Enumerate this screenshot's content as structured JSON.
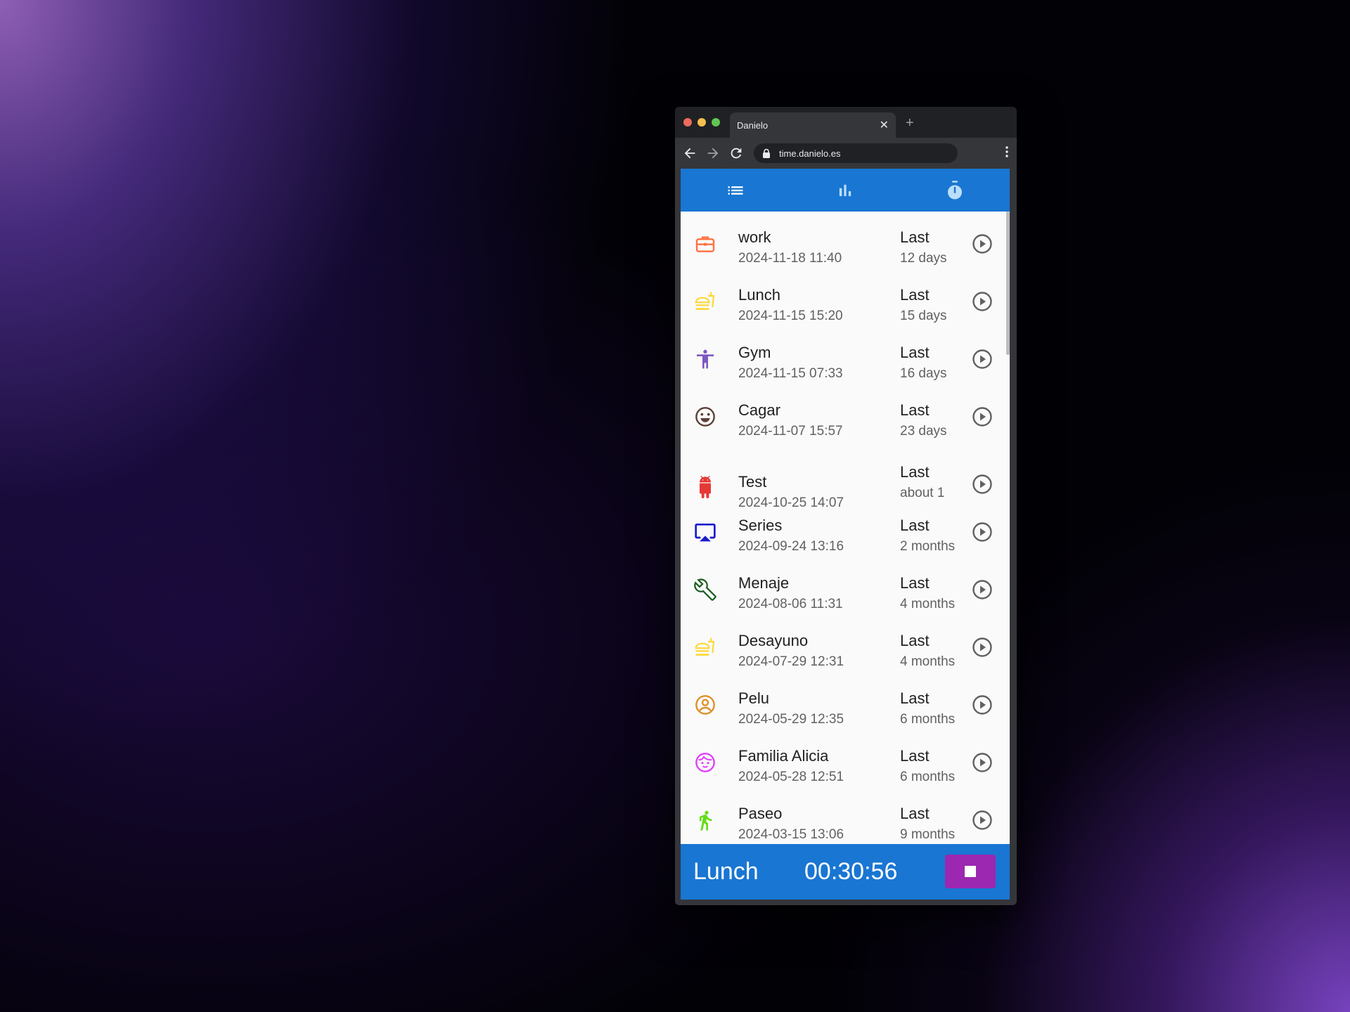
{
  "browser": {
    "tab_title": "Danielo",
    "url": "time.danielo.es",
    "close_glyph": "✕",
    "new_tab_glyph": "+"
  },
  "app_bar": {
    "tabs": [
      {
        "icon": "list-icon",
        "active": true
      },
      {
        "icon": "bar-chart-icon",
        "active": false
      },
      {
        "icon": "timer-icon",
        "active": false
      }
    ]
  },
  "activities": [
    {
      "name": "work",
      "date": "2024-11-18 11:40",
      "last_label": "Last",
      "ago": "12 days",
      "icon": "briefcase-icon",
      "color": "#ff7043"
    },
    {
      "name": "Lunch",
      "date": "2024-11-15 15:20",
      "last_label": "Last",
      "ago": "15 days",
      "icon": "fastfood-icon",
      "color": "#fdd835"
    },
    {
      "name": "Gym",
      "date": "2024-11-15 07:33",
      "last_label": "Last",
      "ago": "16 days",
      "icon": "accessibility-icon",
      "color": "#7e57c2"
    },
    {
      "name": "Cagar",
      "date": "2024-11-07 15:57",
      "last_label": "Last",
      "ago": "23 days",
      "icon": "smiley-icon",
      "color": "#5d4037"
    },
    {
      "name": "Test",
      "date": "2024-10-25 14:07",
      "last_label": "Last",
      "ago": "about 1",
      "icon": "android-icon",
      "color": "#e53935"
    },
    {
      "name": "Series",
      "date": "2024-09-24 13:16",
      "last_label": "Last",
      "ago": "2 months",
      "icon": "airplay-icon",
      "color": "#1a1acc"
    },
    {
      "name": "Menaje",
      "date": "2024-08-06 11:31",
      "last_label": "Last",
      "ago": "4 months",
      "icon": "wrench-icon",
      "color": "#1b5e20"
    },
    {
      "name": "Desayuno",
      "date": "2024-07-29 12:31",
      "last_label": "Last",
      "ago": "4 months",
      "icon": "fastfood-icon",
      "color": "#fdd835"
    },
    {
      "name": "Pelu",
      "date": "2024-05-29 12:35",
      "last_label": "Last",
      "ago": "6 months",
      "icon": "account-circle-icon",
      "color": "#e0902a"
    },
    {
      "name": "Familia Alicia",
      "date": "2024-05-28 12:51",
      "last_label": "Last",
      "ago": "6 months",
      "icon": "child-face-icon",
      "color": "#e040fb"
    },
    {
      "name": "Paseo",
      "date": "2024-03-15 13:06",
      "last_label": "Last",
      "ago": "9 months",
      "icon": "run-icon",
      "color": "#64dd17"
    }
  ],
  "current": {
    "activity": "Lunch",
    "timer": "00:30:56"
  },
  "colors": {
    "primary": "#1976d2",
    "stop_button": "#9c27b0"
  }
}
